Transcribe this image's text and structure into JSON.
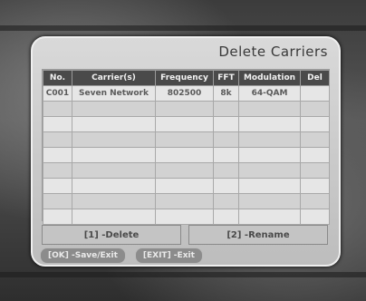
{
  "dialog": {
    "title": "Delete Carriers"
  },
  "table": {
    "headers": [
      "No.",
      "Carrier(s)",
      "Frequency",
      "FFT",
      "Modulation",
      "Del"
    ],
    "rows": [
      [
        "C001",
        "Seven Network",
        "802500",
        "8k",
        "64-QAM",
        ""
      ],
      [
        "",
        "",
        "",
        "",
        "",
        ""
      ],
      [
        "",
        "",
        "",
        "",
        "",
        ""
      ],
      [
        "",
        "",
        "",
        "",
        "",
        ""
      ],
      [
        "",
        "",
        "",
        "",
        "",
        ""
      ],
      [
        "",
        "",
        "",
        "",
        "",
        ""
      ],
      [
        "",
        "",
        "",
        "",
        "",
        ""
      ],
      [
        "",
        "",
        "",
        "",
        "",
        ""
      ],
      [
        "",
        "",
        "",
        "",
        "",
        ""
      ]
    ]
  },
  "actions": {
    "delete_label": "[1] -Delete",
    "rename_label": "[2] -Rename"
  },
  "footer": {
    "save_hint": "[OK] -Save/Exit",
    "exit_hint": "[EXIT] -Exit"
  }
}
